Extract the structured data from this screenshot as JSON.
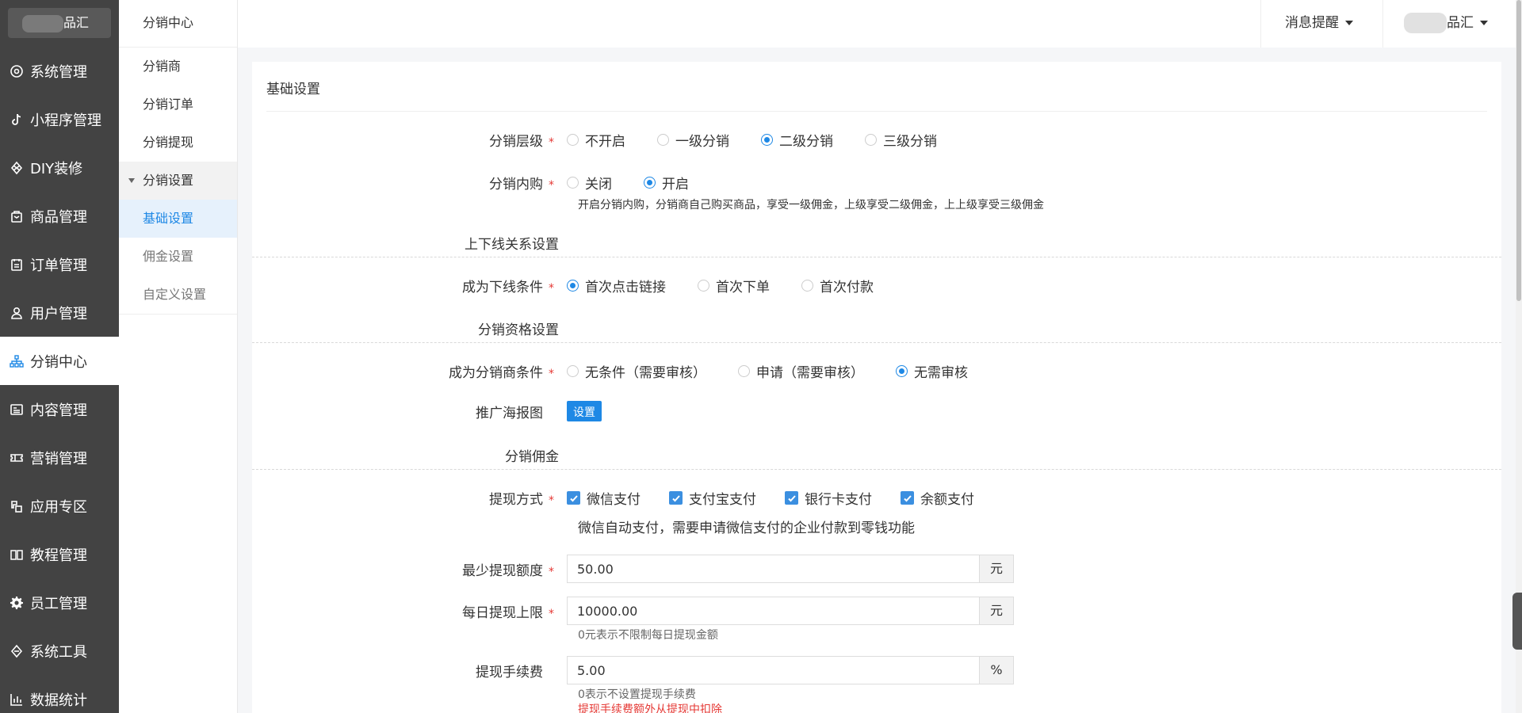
{
  "app": {
    "logo_text": "品汇"
  },
  "sidebar": {
    "items": [
      {
        "label": "系统管理",
        "icon": "gear-circle-icon"
      },
      {
        "label": "小程序管理",
        "icon": "tiktok-icon"
      },
      {
        "label": "DIY装修",
        "icon": "diamond-icon"
      },
      {
        "label": "商品管理",
        "icon": "bag-icon"
      },
      {
        "label": "订单管理",
        "icon": "clipboard-icon"
      },
      {
        "label": "用户管理",
        "icon": "user-icon"
      },
      {
        "label": "分销中心",
        "icon": "sitemap-icon",
        "active": true
      },
      {
        "label": "内容管理",
        "icon": "article-icon"
      },
      {
        "label": "营销管理",
        "icon": "ticket-icon"
      },
      {
        "label": "应用专区",
        "icon": "apps-icon"
      },
      {
        "label": "教程管理",
        "icon": "book-icon"
      },
      {
        "label": "员工管理",
        "icon": "gear-icon"
      },
      {
        "label": "系统工具",
        "icon": "tools-icon"
      },
      {
        "label": "数据统计",
        "icon": "bar-chart-icon"
      }
    ]
  },
  "subnav": {
    "title": "分销中心",
    "items": [
      {
        "label": "分销商"
      },
      {
        "label": "分销订单"
      },
      {
        "label": "分销提现"
      }
    ],
    "group": {
      "label": "分销设置"
    },
    "children": [
      {
        "label": "基础设置",
        "selected": true
      },
      {
        "label": "佣金设置"
      },
      {
        "label": "自定义设置"
      }
    ]
  },
  "header": {
    "messages_label": "消息提醒",
    "user_label": "品汇"
  },
  "main": {
    "title": "基础设置",
    "level": {
      "label": "分销层级",
      "options": [
        "不开启",
        "一级分销",
        "二级分销",
        "三级分销"
      ],
      "selected": 2
    },
    "self_buy": {
      "label": "分销内购",
      "options": [
        "关闭",
        "开启"
      ],
      "selected": 1,
      "hint": "开启分销内购，分销商自己购买商品，享受一级佣金，上级享受二级佣金，上上级享受三级佣金"
    },
    "section_relation": "上下线关系设置",
    "downline": {
      "label": "成为下线条件",
      "options": [
        "首次点击链接",
        "首次下单",
        "首次付款"
      ],
      "selected": 0
    },
    "section_qualification": "分销资格设置",
    "distributor": {
      "label": "成为分销商条件",
      "options": [
        "无条件（需要审核）",
        "申请（需要审核）",
        "无需审核"
      ],
      "selected": 2
    },
    "poster": {
      "label": "推广海报图",
      "button": "设置"
    },
    "section_commission": "分销佣金",
    "withdraw_method": {
      "label": "提现方式",
      "options": [
        "微信支付",
        "支付宝支付",
        "银行卡支付",
        "余额支付"
      ],
      "hint": "微信自动支付，需要申请微信支付的企业付款到零钱功能"
    },
    "min_withdraw": {
      "label": "最少提现额度",
      "value": "50.00",
      "unit": "元"
    },
    "daily_limit": {
      "label": "每日提现上限",
      "value": "10000.00",
      "unit": "元",
      "hint": "0元表示不限制每日提现金额"
    },
    "fee": {
      "label": "提现手续费",
      "value": "5.00",
      "unit": "%",
      "hint": "0表示不设置提现手续费",
      "hint_red": "提现手续费额外从提现中扣除"
    }
  },
  "colors": {
    "sidebar_bg": "#434343",
    "accent": "#1e88e5",
    "required": "#e53935"
  }
}
